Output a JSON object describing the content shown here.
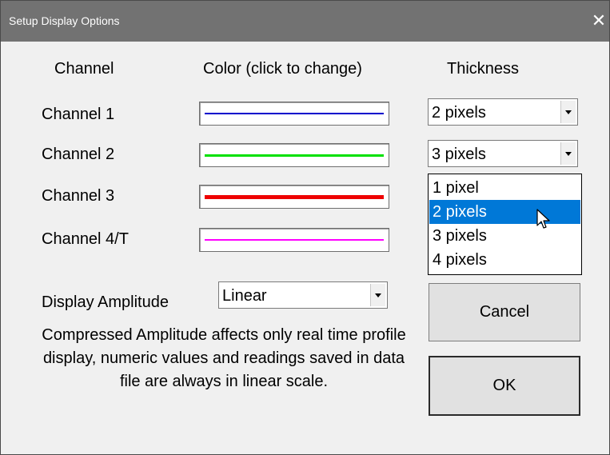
{
  "window": {
    "title": "Setup Display Options",
    "close_glyph": "✕"
  },
  "headers": {
    "channel": "Channel",
    "color": "Color (click to change)",
    "thickness": "Thickness"
  },
  "channels": [
    {
      "label": "Channel 1",
      "color": "#0000cc",
      "thickness": "2 pixels"
    },
    {
      "label": "Channel 2",
      "color": "#00e000",
      "thickness": "3 pixels"
    },
    {
      "label": "Channel 3",
      "color": "#ee0000"
    },
    {
      "label": "Channel 4/T",
      "color": "#ff00ff"
    }
  ],
  "thickness_dropdown": {
    "options": [
      "1 pixel",
      "2 pixels",
      "3 pixels",
      "4 pixels"
    ],
    "highlighted": "2 pixels",
    "highlight_color": "#0078d7"
  },
  "amplitude": {
    "label": "Display Amplitude",
    "value": "Linear"
  },
  "note": "Compressed Amplitude affects only real time profile display, numeric values and readings saved in data file are always in linear scale.",
  "buttons": {
    "cancel": "Cancel",
    "ok": "OK"
  },
  "icons": {
    "close": "close-icon",
    "dropdown_arrow": "chevron-down-icon",
    "cursor": "mouse-pointer-icon"
  }
}
